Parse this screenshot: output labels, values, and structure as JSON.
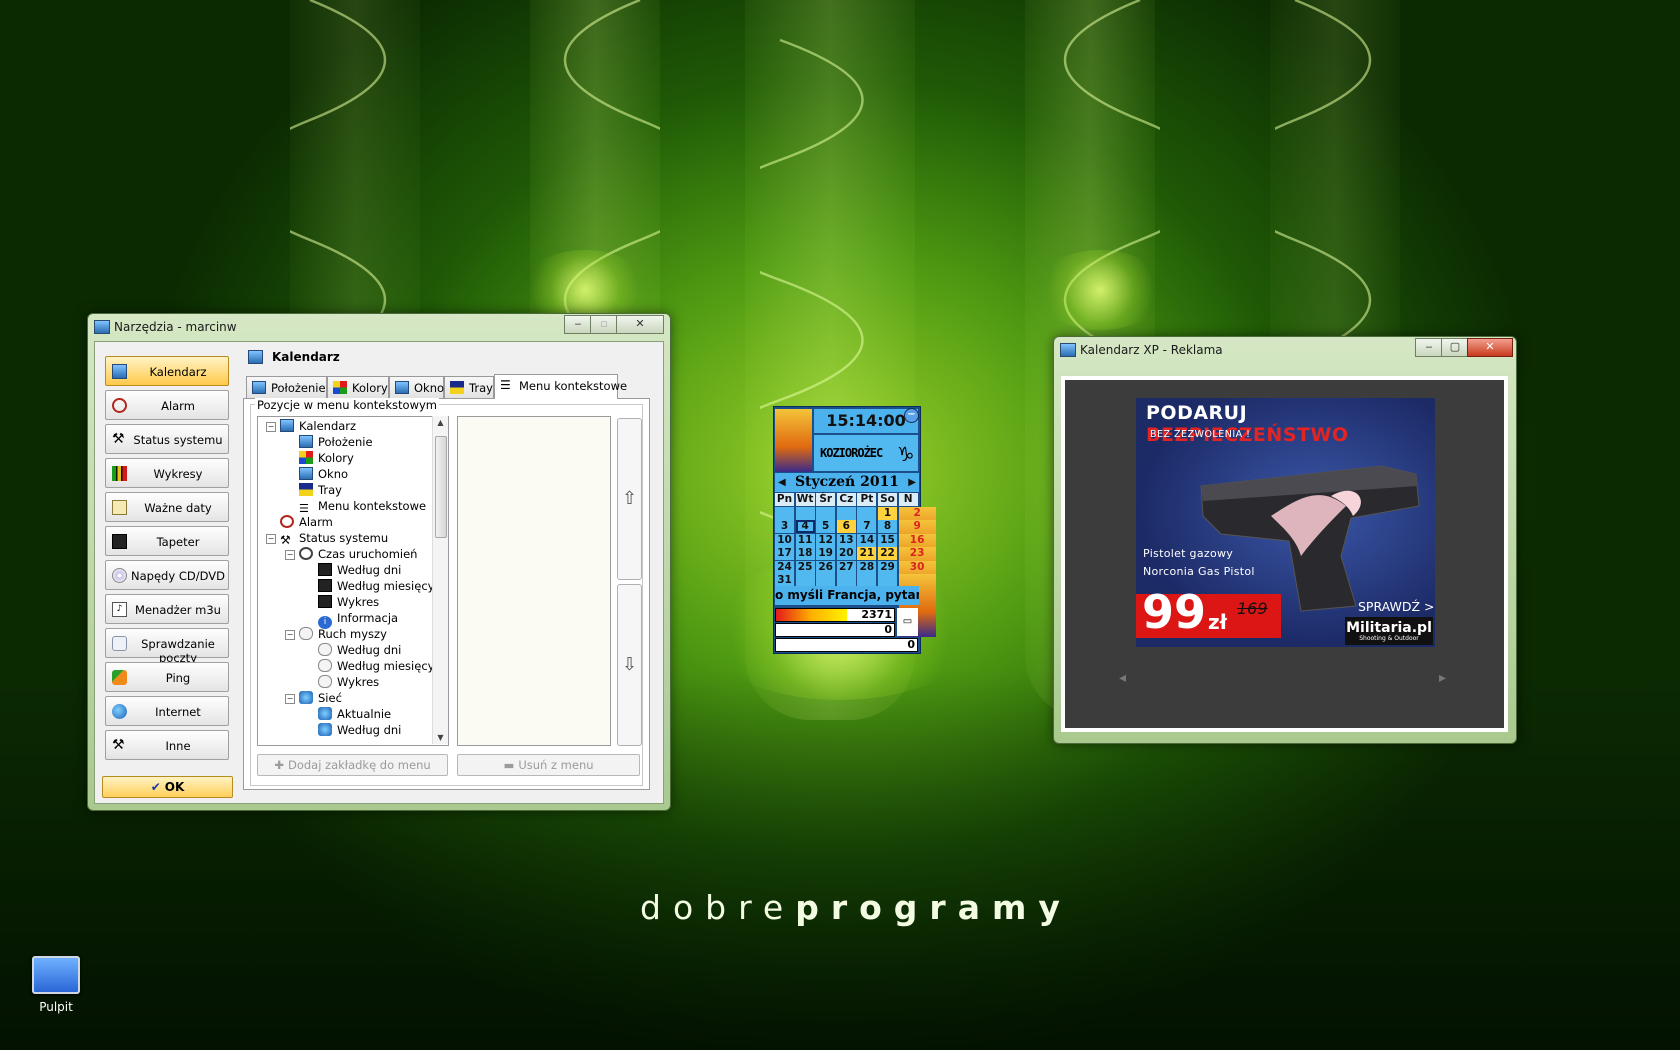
{
  "desktop": {
    "logo_light": "dobre",
    "logo_bold": "programy",
    "icon_label": "Pulpit"
  },
  "tools_window": {
    "title": "Narzędzia - marcinw",
    "page_title": "Kalendarz",
    "sidebar": [
      {
        "label": "Kalendarz",
        "icon": "calendar-icon",
        "active": true
      },
      {
        "label": "Alarm",
        "icon": "alarm-clock-icon"
      },
      {
        "label": "Status systemu",
        "icon": "tools-icon"
      },
      {
        "label": "Wykresy",
        "icon": "chart-icon"
      },
      {
        "label": "Ważne daty",
        "icon": "date-icon"
      },
      {
        "label": "Tapeter",
        "icon": "monitor-icon"
      },
      {
        "label": "Napędy CD/DVD",
        "icon": "cd-icon"
      },
      {
        "label": "Menadżer m3u",
        "icon": "playlist-icon"
      },
      {
        "label": "Sprawdzanie poczty",
        "icon": "mail-icon"
      },
      {
        "label": "Ping",
        "icon": "ping-icon"
      },
      {
        "label": "Internet",
        "icon": "globe-icon"
      },
      {
        "label": "Inne",
        "icon": "hammer-icon"
      }
    ],
    "ok_label": "OK",
    "tabs": [
      {
        "label": "Położenie"
      },
      {
        "label": "Kolory"
      },
      {
        "label": "Okno"
      },
      {
        "label": "Tray"
      },
      {
        "label": "Menu kontekstowe",
        "selected": true
      }
    ],
    "group_label": "Pozycje w menu kontekstowym",
    "tree": [
      {
        "label": "Kalendarz",
        "level": 0,
        "expander": "minus"
      },
      {
        "label": "Położenie",
        "level": 1
      },
      {
        "label": "Kolory",
        "level": 1
      },
      {
        "label": "Okno",
        "level": 1
      },
      {
        "label": "Tray",
        "level": 1
      },
      {
        "label": "Menu kontekstowe",
        "level": 1
      },
      {
        "label": "Alarm",
        "level": 0
      },
      {
        "label": "Status systemu",
        "level": 0,
        "expander": "minus"
      },
      {
        "label": "Czas uruchomień",
        "level": 1,
        "expander": "minus"
      },
      {
        "label": "Według dni",
        "level": 2
      },
      {
        "label": "Według miesięcy",
        "level": 2
      },
      {
        "label": "Wykres",
        "level": 2
      },
      {
        "label": "Informacja",
        "level": 2
      },
      {
        "label": "Ruch myszy",
        "level": 1,
        "expander": "minus"
      },
      {
        "label": "Według dni",
        "level": 2
      },
      {
        "label": "Według miesięcy",
        "level": 2
      },
      {
        "label": "Wykres",
        "level": 2
      },
      {
        "label": "Sieć",
        "level": 1,
        "expander": "minus"
      },
      {
        "label": "Aktualnie",
        "level": 2
      },
      {
        "label": "Według dni",
        "level": 2
      }
    ],
    "add_button": "Dodaj zakładkę do menu",
    "remove_button": "Usuń z menu"
  },
  "calendar_widget": {
    "time": "15:14:00",
    "zodiac": "KOZIOROŻEC",
    "zodiac_symbol": "♑",
    "month": "Styczeń 2011",
    "weekdays": [
      "Pn",
      "Wt",
      "Śr",
      "Cz",
      "Pt",
      "So",
      "N"
    ],
    "weeks": [
      [
        "",
        "",
        "",
        "",
        "",
        "1",
        "2"
      ],
      [
        "3",
        "4",
        "5",
        "6",
        "7",
        "8",
        "9"
      ],
      [
        "10",
        "11",
        "12",
        "13",
        "14",
        "15",
        "16"
      ],
      [
        "17",
        "18",
        "19",
        "20",
        "21",
        "22",
        "23"
      ],
      [
        "24",
        "25",
        "26",
        "27",
        "28",
        "29",
        "30"
      ],
      [
        "31",
        "",
        "",
        "",
        "",
        "",
        ""
      ]
    ],
    "highlighted_days": [
      "1",
      "6",
      "21",
      "22"
    ],
    "today": "4",
    "ticker": "o myśli Francja, pytan",
    "counter1": "2371",
    "counter2": "0",
    "counter3": "0",
    "bar_fraction": 0.6
  },
  "ad_window": {
    "title": "Kalendarz XP - Reklama",
    "headline_white": "PODARUJ",
    "headline_red": "BEZPIECZEŃSTWO",
    "subheadline": "BEZ ZEZWOLENIA !",
    "product_line1": "Pistolet gazowy",
    "product_line2": "Norconia Gas Pistol",
    "price": "99",
    "currency": "zł",
    "old_price": "169",
    "cta": "SPRAWDŹ >",
    "brand": "Militaria.pl",
    "brand_sub": "Shooting & Outdoor"
  }
}
